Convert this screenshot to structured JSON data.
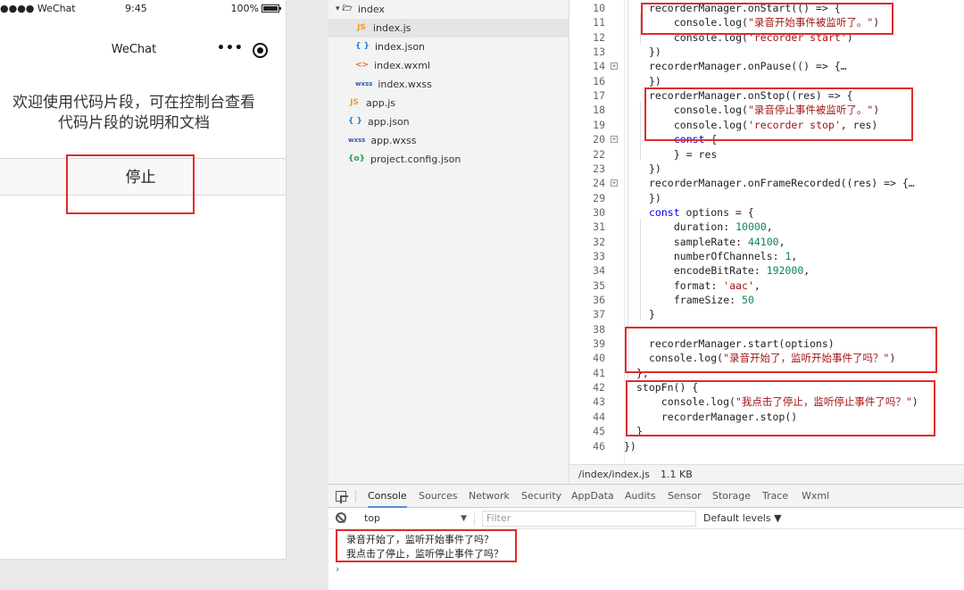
{
  "phone": {
    "carrier": "●●●● WeChat",
    "time": "9:45",
    "battery": "100%",
    "nav_title": "WeChat",
    "more_icon": "•••",
    "intro_line1": "欢迎使用代码片段，可在控制台查看",
    "intro_line2": "代码片段的说明和文档",
    "stop_button": "停止"
  },
  "filetree": {
    "items": [
      {
        "name": "index",
        "icon": "▾ 🗁"
      },
      {
        "name": "index.js",
        "icon": "JS"
      },
      {
        "name": "index.json",
        "icon": "{ }"
      },
      {
        "name": "index.wxml",
        "icon": "<>"
      },
      {
        "name": "index.wxss",
        "icon": "wxss"
      },
      {
        "name": "app.js",
        "icon": "JS"
      },
      {
        "name": "app.json",
        "icon": "{ }"
      },
      {
        "name": "app.wxss",
        "icon": "wxss"
      },
      {
        "name": "project.config.json",
        "icon": "{o}"
      }
    ]
  },
  "editor": {
    "lines": [
      {
        "n": "10",
        "code": "recorderManager.onStart(() => {"
      },
      {
        "n": "11",
        "code": "  console.log(\"录音开始事件被监听了。\")"
      },
      {
        "n": "12",
        "code": "  console.log('recorder start')"
      },
      {
        "n": "13",
        "code": "})"
      },
      {
        "n": "14",
        "code": "recorderManager.onPause(() => {…"
      },
      {
        "n": "16",
        "code": "})"
      },
      {
        "n": "17",
        "code": "recorderManager.onStop((res) => {"
      },
      {
        "n": "18",
        "code": "  console.log(\"录音停止事件被监听了。\")"
      },
      {
        "n": "19",
        "code": "  console.log('recorder stop', res)"
      },
      {
        "n": "20",
        "code": "  const {"
      },
      {
        "n": "22",
        "code": "  } = res"
      },
      {
        "n": "23",
        "code": "})"
      },
      {
        "n": "24",
        "code": "recorderManager.onFrameRecorded((res) => {…"
      },
      {
        "n": "29",
        "code": "})"
      },
      {
        "n": "30",
        "code": "const options = {"
      },
      {
        "n": "31",
        "code": "  duration: 10000,"
      },
      {
        "n": "32",
        "code": "  sampleRate: 44100,"
      },
      {
        "n": "33",
        "code": "  numberOfChannels: 1,"
      },
      {
        "n": "34",
        "code": "  encodeBitRate: 192000,"
      },
      {
        "n": "35",
        "code": "  format: 'aac',"
      },
      {
        "n": "36",
        "code": "  frameSize: 50"
      },
      {
        "n": "37",
        "code": "}"
      },
      {
        "n": "38",
        "code": ""
      },
      {
        "n": "39",
        "code": "recorderManager.start(options)"
      },
      {
        "n": "40",
        "code": "console.log(\"录音开始了，监听开始事件了吗？\")"
      },
      {
        "n": "41",
        "code": "},"
      },
      {
        "n": "42",
        "code": "stopFn() {"
      },
      {
        "n": "43",
        "code": "  console.log(\"我点击了停止，监听停止事件了吗？\")"
      },
      {
        "n": "44",
        "code": "  recorderManager.stop()"
      },
      {
        "n": "45",
        "code": "}"
      },
      {
        "n": "46",
        "code": "})"
      }
    ],
    "file_path": "/index/index.js",
    "file_size": "1.1 KB"
  },
  "devtools": {
    "tabs": [
      "Console",
      "Sources",
      "Network",
      "Security",
      "AppData",
      "Audits",
      "Sensor",
      "Storage",
      "Trace",
      "Wxml"
    ],
    "context": "top",
    "filter_placeholder": "Filter",
    "levels": "Default levels ▼",
    "logs": [
      "录音开始了，监听开始事件了吗？",
      "我点击了停止，监听停止事件了吗？"
    ],
    "prompt": "›"
  },
  "colors": {
    "annotation": "#e02b2b",
    "string": "#a31515",
    "number": "#098658",
    "keyword": "#0000ff"
  }
}
